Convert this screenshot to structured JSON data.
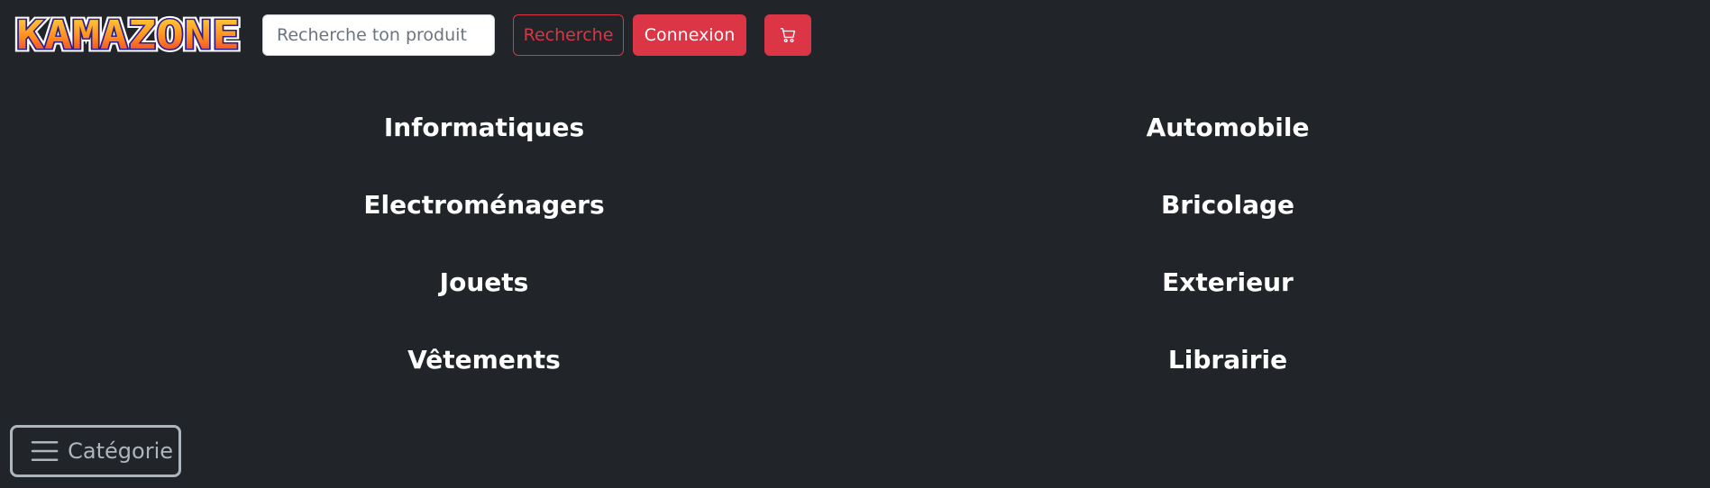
{
  "brand": {
    "logo_text": "KAMAZONE"
  },
  "header": {
    "search_placeholder": "Recherche ton produit",
    "search_value": "",
    "search_button": "Recherche",
    "login_button": "Connexion",
    "cart_icon": "cart-icon"
  },
  "categories": {
    "items": [
      "Informatiques",
      "Automobile",
      "Electroménagers",
      "Bricolage",
      "Jouets",
      "Exterieur",
      "Vêtements",
      "Librairie"
    ]
  },
  "category_toggle": {
    "label": "Catégorie",
    "icon": "menu-icon"
  },
  "colors": {
    "background": "#212529",
    "accent": "#dc3545",
    "text": "#ffffff",
    "muted": "#adb5bd"
  }
}
